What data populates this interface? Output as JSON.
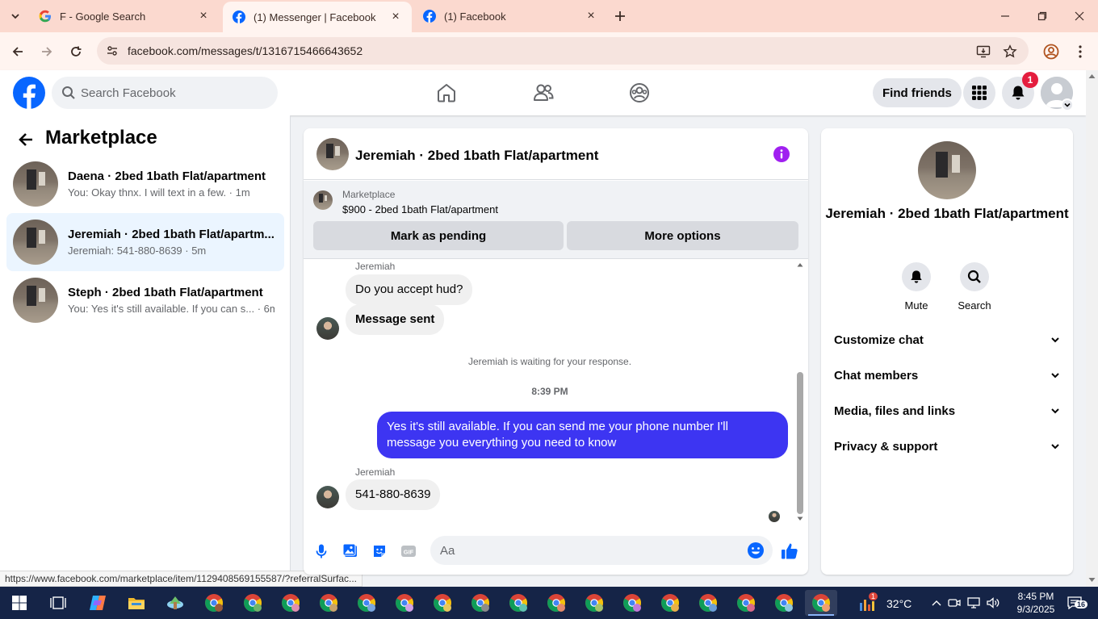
{
  "browser": {
    "tabs": [
      {
        "title": "F - Google Search",
        "favicon": "google-icon",
        "active": false
      },
      {
        "title": "(1) Messenger | Facebook",
        "favicon": "facebook-icon",
        "active": true
      },
      {
        "title": "(1) Facebook",
        "favicon": "facebook-icon",
        "active": false
      }
    ],
    "url": "facebook.com/messages/t/1316715466643652",
    "status_url": "https://www.facebook.com/marketplace/item/1129408569155587/?referralSurfac..."
  },
  "fb_header": {
    "search_placeholder": "Search Facebook",
    "find_friends_label": "Find friends",
    "notification_count": "1",
    "brand_color": "#0866ff"
  },
  "left_panel": {
    "title": "Marketplace",
    "conversations": [
      {
        "name": "Daena · 2bed 1bath Flat/apartment",
        "preview": "You: Okay thnx. I will text in a few. · 1m",
        "active": false
      },
      {
        "name": "Jeremiah · 2bed 1bath Flat/apartm...",
        "preview": "Jeremiah: 541-880-8639 · 5m",
        "active": true
      },
      {
        "name": "Steph · 2bed 1bath Flat/apartment",
        "preview": "You: Yes it's still available. If you can s... · 6m",
        "active": false
      }
    ]
  },
  "chat": {
    "title": "Jeremiah · 2bed 1bath Flat/apartment",
    "marketplace_label": "Marketplace",
    "listing": "$900 - 2bed 1bath Flat/apartment",
    "mark_pending_label": "Mark as pending",
    "more_options_label": "More options",
    "messages": {
      "sender_1": "Jeremiah",
      "msg_1": "Do you accept hud?",
      "msg_2": "Message sent",
      "waiting_note": "Jeremiah is waiting for your response.",
      "time": "8:39 PM",
      "msg_out": "Yes it's still available. If you can send me your phone number I'll message you everything you need to know",
      "sender_2": "Jeremiah",
      "msg_3": "541-880-8639"
    },
    "composer_placeholder": "Aa",
    "outgoing_color": "#3d35f2"
  },
  "info_panel": {
    "name": "Jeremiah · 2bed 1bath Flat/apartment",
    "mute_label": "Mute",
    "search_label": "Search",
    "sections": [
      "Customize chat",
      "Chat members",
      "Media, files and links",
      "Privacy & support"
    ]
  },
  "taskbar": {
    "temperature": "32°C",
    "weather_badge": "1",
    "time": "8:45 PM",
    "date": "9/3/2025",
    "notification_count": "16"
  }
}
